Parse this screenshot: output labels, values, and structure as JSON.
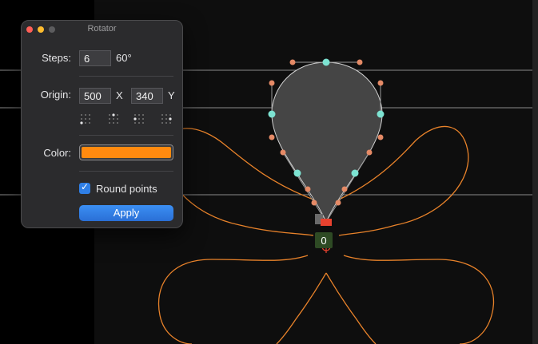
{
  "window": {
    "title": "Rotator"
  },
  "steps": {
    "label": "Steps:",
    "value": "6",
    "angle": "60°"
  },
  "origin": {
    "label": "Origin:",
    "x_value": "500",
    "x_label": "X",
    "y_value": "340",
    "y_label": "Y",
    "presets": [
      "bottom-left",
      "top-center",
      "center-left",
      "center-right"
    ]
  },
  "color": {
    "label": "Color:",
    "value": "#ff8a0f"
  },
  "round_points": {
    "label": "Round points",
    "checked": true
  },
  "apply": {
    "label": "Apply"
  },
  "canvas": {
    "glyph_outline_color": "#e8822a",
    "point_count_label": "0",
    "on_curve_color": "#7de3d2",
    "off_curve_color": "#e58a66"
  }
}
